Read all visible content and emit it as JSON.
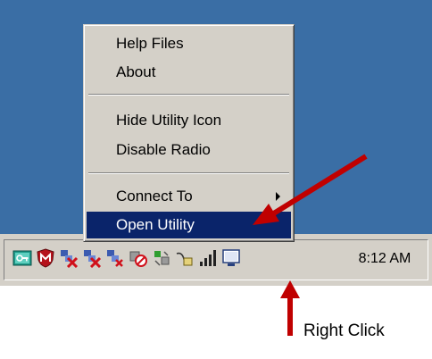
{
  "context_menu": {
    "items": [
      {
        "label": "Help Files"
      },
      {
        "label": "About"
      },
      {
        "label": "Hide Utility Icon"
      },
      {
        "label": "Disable Radio"
      },
      {
        "label": "Connect To",
        "has_submenu": true
      },
      {
        "label": "Open Utility",
        "highlighted": true
      }
    ]
  },
  "taskbar": {
    "clock": "8:12 AM",
    "tray_icons": [
      "key-icon",
      "mcafee-shield-icon",
      "network-disconnected-icon",
      "network-disconnected-icon-2",
      "network-disconnected-icon-3",
      "blocked-icon",
      "network-activity-icon",
      "usb-hardware-icon",
      "wireless-signal-icon",
      "monitor-icon"
    ]
  },
  "annotation": {
    "label": "Right Click",
    "arrow_color": "#c00000"
  },
  "colors": {
    "desktop": "#3a6ea5",
    "menu_highlight": "#0a246a",
    "menu_bg": "#d4d0c8"
  }
}
